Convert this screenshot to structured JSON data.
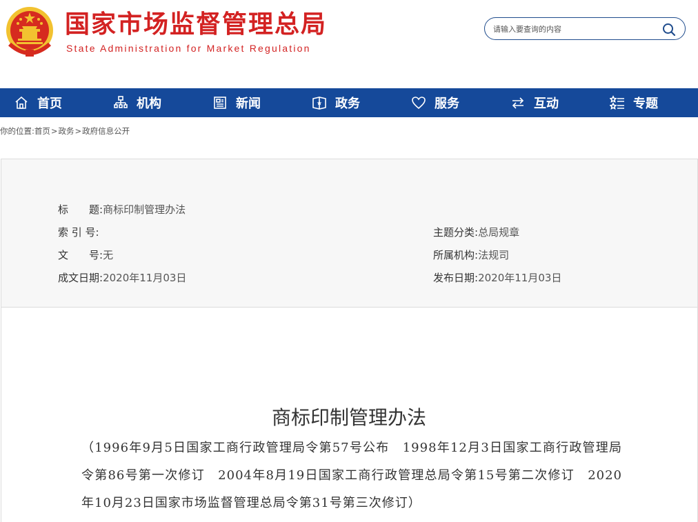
{
  "header": {
    "title": "国家市场监督管理总局",
    "subtitle": "State Administration for Market Regulation"
  },
  "search": {
    "placeholder": "请输入要查询的内容"
  },
  "nav": {
    "items": [
      {
        "label": "首页",
        "icon": "home-icon"
      },
      {
        "label": "机构",
        "icon": "org-icon"
      },
      {
        "label": "新闻",
        "icon": "news-icon"
      },
      {
        "label": "政务",
        "icon": "affairs-icon"
      },
      {
        "label": "服务",
        "icon": "heart-icon"
      },
      {
        "label": "互动",
        "icon": "exchange-icon"
      },
      {
        "label": "专题",
        "icon": "topics-icon"
      }
    ]
  },
  "breadcrumb": {
    "prefix": "你的位置:",
    "items": [
      "首页",
      "政务",
      "政府信息公开"
    ],
    "separator": ">"
  },
  "info": {
    "title_label": "标　　题:",
    "title_value": "商标印制管理办法",
    "index_label": "索 引 号:",
    "index_value": "",
    "topic_label": "主题分类:",
    "topic_value": "总局规章",
    "docno_label": "文　　号:",
    "docno_value": "无",
    "org_label": "所属机构:",
    "org_value": "法规司",
    "created_label": "成文日期:",
    "created_value": "2020年11月03日",
    "published_label": "发布日期:",
    "published_value": "2020年11月03日"
  },
  "document": {
    "title": "商标印制管理办法",
    "history": "（1996年9月5日国家工商行政管理局令第57号公布　1998年12月3日国家工商行政管理局令第86号第一次修订　2004年8月19日国家工商行政管理总局令第15号第二次修订　2020年10月23日国家市场监督管理总局令第31号第三次修订）"
  },
  "colors": {
    "brand_red": "#d32222",
    "nav_blue": "#15499a",
    "emblem_gold": "#f2c230"
  }
}
